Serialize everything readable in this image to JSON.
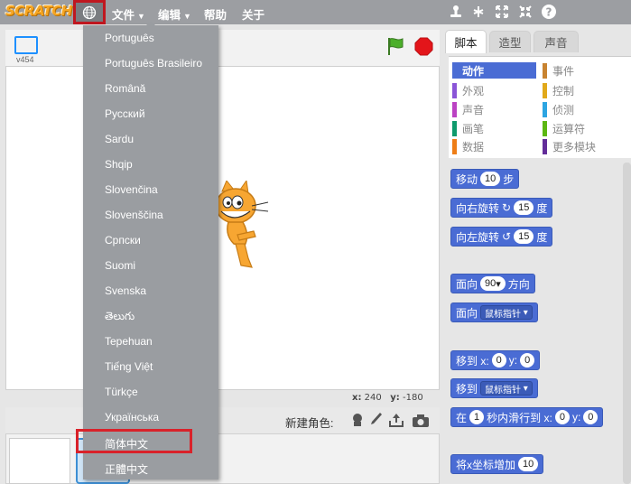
{
  "app": {
    "logo_text": "SCRATCH",
    "version": "v454"
  },
  "menubar": {
    "file": "文件",
    "edit": "编辑",
    "help": "帮助",
    "about": "关于"
  },
  "stage": {
    "coords_x_label": "x:",
    "coords_x": "240",
    "coords_y_label": "y:",
    "coords_y": "-180"
  },
  "sprites": {
    "new_sprite_label": "新建角色:"
  },
  "tabs": [
    "脚本",
    "造型",
    "声音"
  ],
  "categories": [
    {
      "label": "动作",
      "color": "#4a6cd4"
    },
    {
      "label": "事件",
      "color": "#c88330"
    },
    {
      "label": "外观",
      "color": "#8a55d7"
    },
    {
      "label": "控制",
      "color": "#e1a91a"
    },
    {
      "label": "声音",
      "color": "#bb42c3"
    },
    {
      "label": "侦测",
      "color": "#2ca5e2"
    },
    {
      "label": "画笔",
      "color": "#0e9a6c"
    },
    {
      "label": "运算符",
      "color": "#5cb712"
    },
    {
      "label": "数据",
      "color": "#ee7d16"
    },
    {
      "label": "更多模块",
      "color": "#632d99"
    }
  ],
  "blocks": {
    "move": "移动",
    "move_val": "10",
    "steps": "步",
    "turn_right": "向右旋转",
    "turn_right_val": "15",
    "degrees": "度",
    "turn_left": "向左旋转",
    "turn_left_val": "15",
    "point_dir": "面向",
    "point_dir_val": "90",
    "direction": "方向",
    "point_towards": "面向",
    "mouse_pointer": "鼠标指针",
    "goto_xy": "移到 x:",
    "goto_x": "0",
    "y_label": "y:",
    "goto_y": "0",
    "goto": "移到",
    "goto_target": "鼠标指针",
    "glide_in": "在",
    "glide_secs": "1",
    "glide_text": "秒内滑行到 x:",
    "glide_x": "0",
    "glide_y": "0",
    "change_x": "将x坐标增加",
    "change_x_val": "10"
  },
  "languages": [
    "Português",
    "Português Brasileiro",
    "Română",
    "Русский",
    "Sardu",
    "Shqip",
    "Slovenčina",
    "Slovenščina",
    "Српски",
    "Suomi",
    "Svenska",
    "తెలుగు",
    "Tepehuan",
    "Tiếng Việt",
    "Türkçe",
    "Українська",
    "简体中文",
    "正體中文"
  ],
  "highlighted_language_index": 16,
  "colors": {
    "motion": "#4a6cd4",
    "highlight": "#d9222a",
    "menubar": "#9c9ea2"
  }
}
